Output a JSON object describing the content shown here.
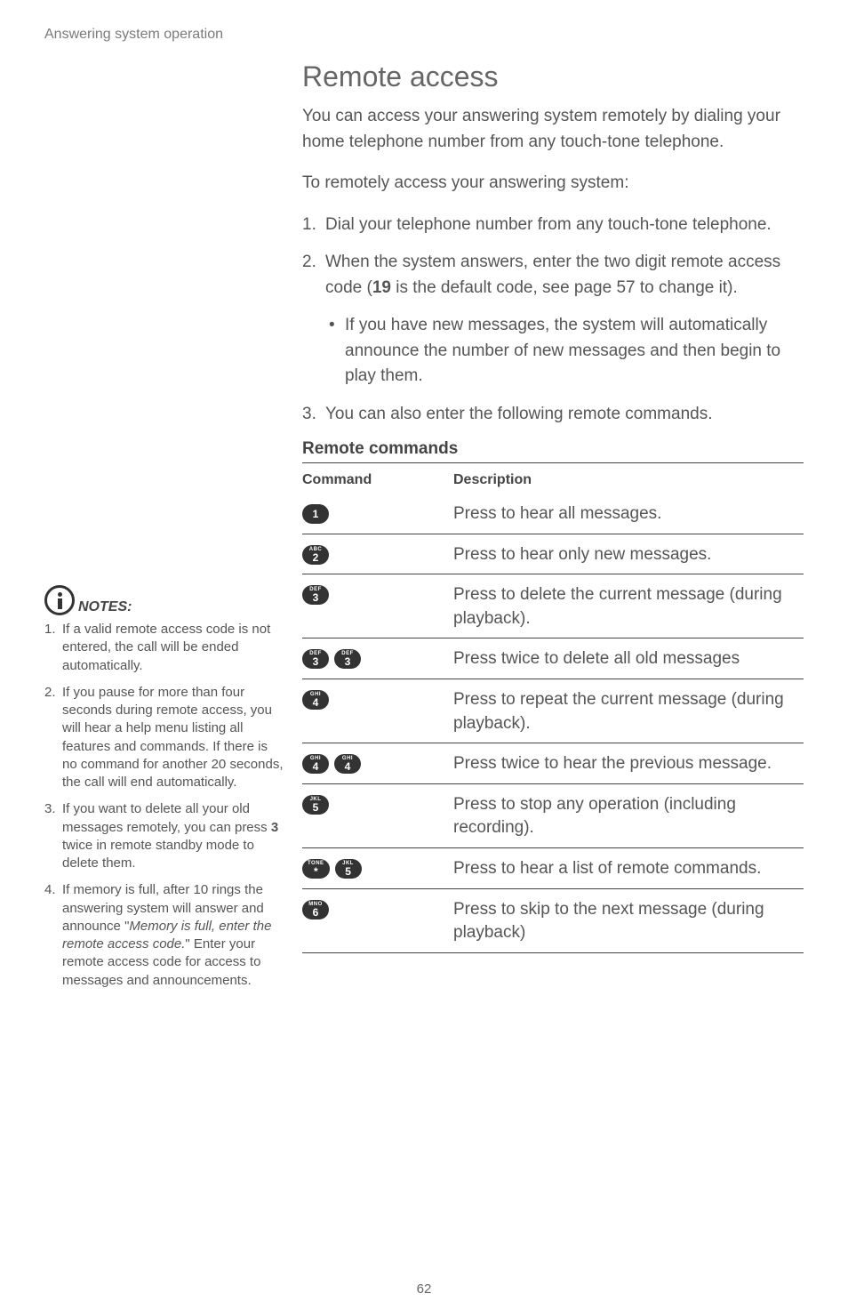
{
  "header": "Answering system operation",
  "title": "Remote access",
  "intro": "You can access your answering system remotely by dialing your home telephone number from any touch-tone telephone.",
  "subintro": "To remotely access your answering system:",
  "steps": [
    {
      "n": "1.",
      "text": "Dial your telephone number from any touch-tone telephone."
    },
    {
      "n": "2.",
      "text_pre": "When the system answers, enter the two digit remote access code (",
      "bold": "19",
      "text_post": " is the default code, see page 57 to change it)."
    }
  ],
  "sub_bullet": "If you have new messages, the system will automatically announce the number of new messages and then begin to play them.",
  "step3": {
    "n": "3.",
    "text": "You can also enter the following remote commands."
  },
  "table_heading": "Remote commands",
  "th_command": "Command",
  "th_description": "Description",
  "rows": [
    {
      "keys": [
        {
          "sup": "",
          "main": "1"
        }
      ],
      "desc": "Press to hear all messages."
    },
    {
      "keys": [
        {
          "sup": "ABC",
          "main": "2"
        }
      ],
      "desc": "Press to hear only new messages."
    },
    {
      "keys": [
        {
          "sup": "DEF",
          "main": "3"
        }
      ],
      "desc": "Press to delete the current message (during playback)."
    },
    {
      "keys": [
        {
          "sup": "DEF",
          "main": "3"
        },
        {
          "sup": "DEF",
          "main": "3"
        }
      ],
      "desc": "Press twice to delete all old messages"
    },
    {
      "keys": [
        {
          "sup": "GHI",
          "main": "4"
        }
      ],
      "desc": "Press to repeat the current message (during playback)."
    },
    {
      "keys": [
        {
          "sup": "GHI",
          "main": "4"
        },
        {
          "sup": "GHI",
          "main": "4"
        }
      ],
      "desc": "Press twice to hear the previous message."
    },
    {
      "keys": [
        {
          "sup": "JKL",
          "main": "5"
        }
      ],
      "desc": "Press to stop any operation (including recording)."
    },
    {
      "keys": [
        {
          "sup": "TONE",
          "main": "*"
        },
        {
          "sup": "JKL",
          "main": "5"
        }
      ],
      "desc": "Press to hear a list of remote commands."
    },
    {
      "keys": [
        {
          "sup": "MNO",
          "main": "6"
        }
      ],
      "desc": "Press to skip to the next message (during playback)"
    }
  ],
  "notes_label": "NOTES:",
  "notes": [
    {
      "n": "1.",
      "text": "If a valid remote access code is not entered, the call will be ended automatically."
    },
    {
      "n": "2.",
      "text": "If you pause for more than four seconds during remote access, you will hear a help menu listing all features and commands. If there is no command for another 20 seconds, the call will end automatically."
    },
    {
      "n": "3.",
      "pre": "If you want to delete all your old messages remotely, you can press ",
      "bold": "3",
      "post": " twice in remote standby mode to delete them."
    },
    {
      "n": "4.",
      "pre": "If memory is full, after 10 rings the answering system will answer and announce \"",
      "ital": "Memory is full, enter the remote access code.",
      "post": "\" Enter your remote access code for access to messages and announcements."
    }
  ],
  "page_number": "62"
}
